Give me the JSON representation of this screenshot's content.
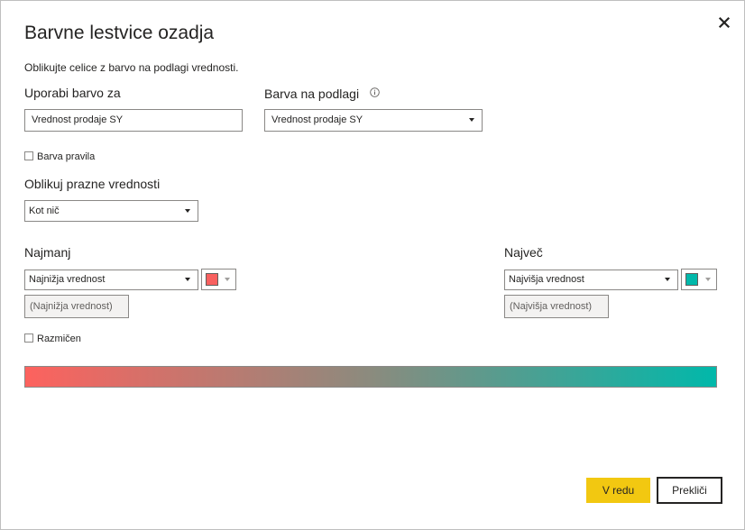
{
  "dialog": {
    "title": "Barvne lestvice ozadja",
    "description": "Oblikujte celice z barvo na podlagi vrednosti."
  },
  "apply_to": {
    "label": "Uporabi barvo za",
    "value": "Vrednost prodaje SY"
  },
  "based_on": {
    "label": "Barva na podlagi",
    "value": "Vrednost prodaje SY"
  },
  "rule_checkbox": {
    "label": "Barva pravila",
    "checked": false
  },
  "blank_values": {
    "label": "Oblikuj prazne vrednosti",
    "value": "Kot nič"
  },
  "minimum": {
    "label": "Najmanj",
    "dropdown_value": "Najnižja vrednost",
    "color": "#f8605f",
    "input_placeholder": "(Najnižja vrednost)"
  },
  "maximum": {
    "label": "Največ",
    "dropdown_value": "Najvišja vrednost",
    "color": "#01b8aa",
    "input_placeholder": "(Najvišja vrednost)"
  },
  "diverging_checkbox": {
    "label": "Razmičen",
    "checked": false
  },
  "gradient": {
    "start_color": "#fd625e",
    "mid_color": "#8b8b7e",
    "end_color": "#01b8aa"
  },
  "buttons": {
    "ok": "V redu",
    "cancel": "Prekliči"
  },
  "icons": {
    "close": "close-icon",
    "info": "info-icon"
  }
}
